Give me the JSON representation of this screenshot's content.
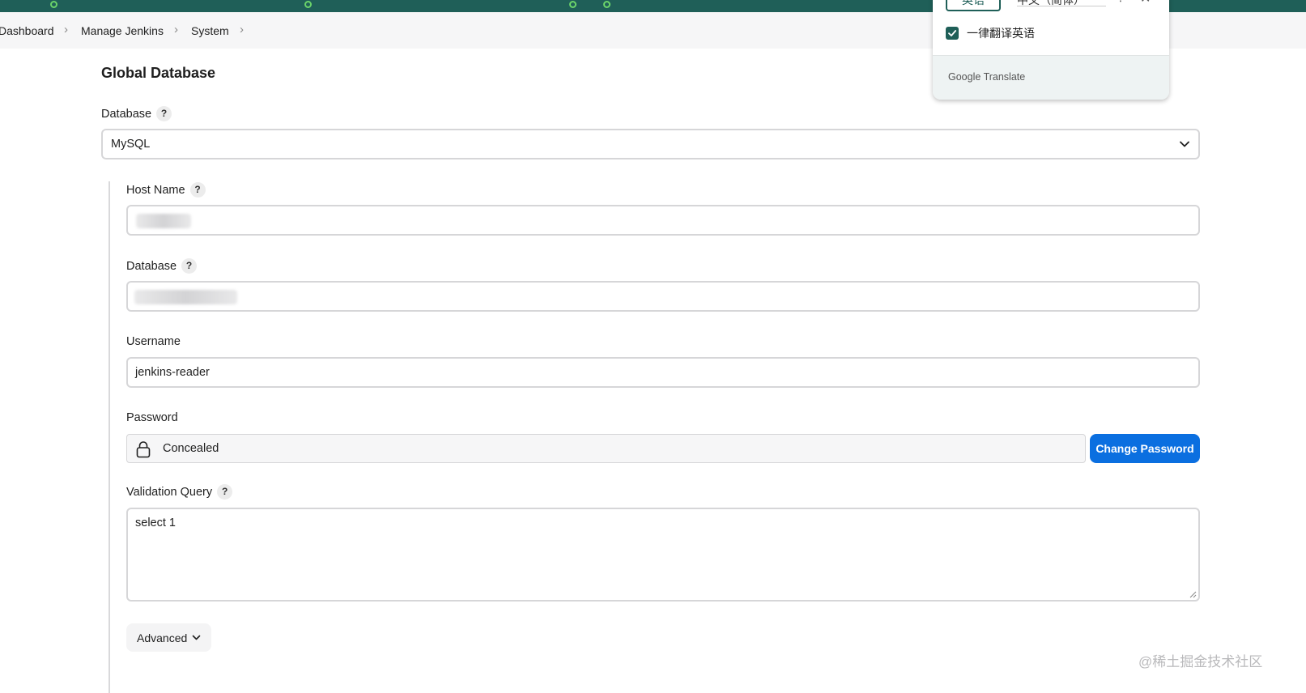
{
  "breadcrumb": {
    "items": [
      "Dashboard",
      "Manage Jenkins",
      "System"
    ],
    "separator": "›"
  },
  "section": {
    "title": "Global Database"
  },
  "database_select": {
    "label": "Database",
    "value": "MySQL"
  },
  "form": {
    "host_name": {
      "label": "Host Name"
    },
    "database": {
      "label": "Database"
    },
    "username": {
      "label": "Username",
      "value": "jenkins-reader"
    },
    "password": {
      "label": "Password",
      "value": "Concealed",
      "change_button": "Change Password"
    },
    "validation_query": {
      "label": "Validation Query",
      "value": "select 1"
    },
    "advanced_button": "Advanced"
  },
  "help_glyph": "?",
  "translate_popup": {
    "tab_source": "英语",
    "tab_target": "中文（简体）",
    "more_icon": "⋮",
    "close_icon": "✕",
    "always_translate_label": "一律翻译英语",
    "always_translate_checked": true,
    "footer_brand": "Google",
    "footer_product": "Translate"
  },
  "watermark": "@稀土掘金技术社区",
  "colors": {
    "accent": "#0b6fe0",
    "chrome_bar": "#1f5f58",
    "border": "#d6d6d8"
  }
}
